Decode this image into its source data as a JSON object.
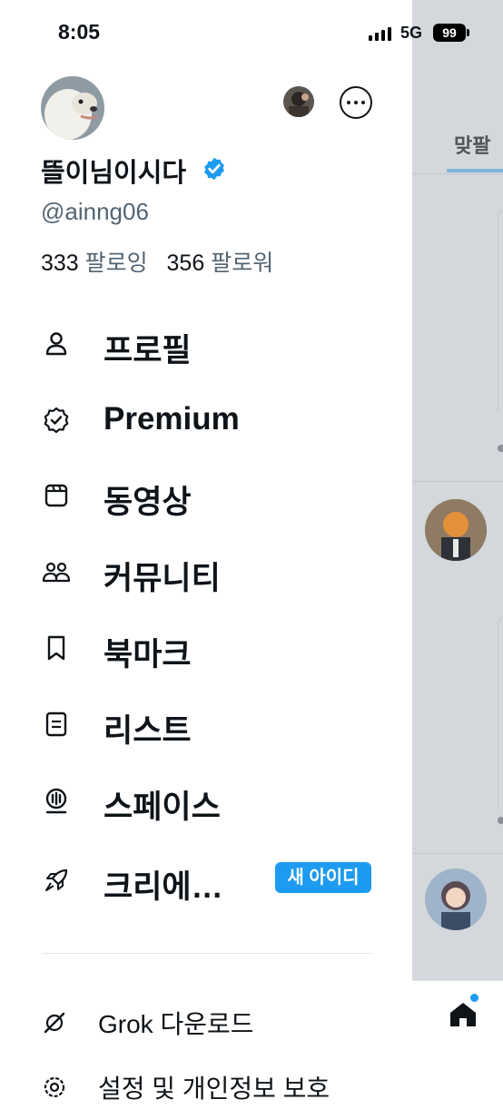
{
  "status_bar": {
    "time": "8:05",
    "network": "5G",
    "battery": "99"
  },
  "profile": {
    "display_name": "뜰이님이시다",
    "handle": "@ainng06",
    "following_count": "333",
    "following_label": "팔로잉",
    "followers_count": "356",
    "followers_label": "팔로워"
  },
  "menu": [
    {
      "label": "프로필",
      "icon": "person-icon"
    },
    {
      "label": "Premium",
      "icon": "premium-badge-icon"
    },
    {
      "label": "동영상",
      "icon": "video-icon"
    },
    {
      "label": "커뮤니티",
      "icon": "communities-icon"
    },
    {
      "label": "북마크",
      "icon": "bookmark-icon"
    },
    {
      "label": "리스트",
      "icon": "list-icon"
    },
    {
      "label": "스페이스",
      "icon": "spaces-icon"
    },
    {
      "label": "크리에…",
      "icon": "rocket-icon",
      "badge": "새 아이디"
    }
  ],
  "secondary": [
    {
      "label": "Grok 다운로드",
      "icon": "grok-icon"
    },
    {
      "label": "설정 및 개인정보 보호",
      "icon": "settings-icon"
    }
  ],
  "background": {
    "tab_label": "맞팔"
  },
  "colors": {
    "accent": "#1d9bf0",
    "text": "#0f1419",
    "secondary_text": "#536471"
  }
}
